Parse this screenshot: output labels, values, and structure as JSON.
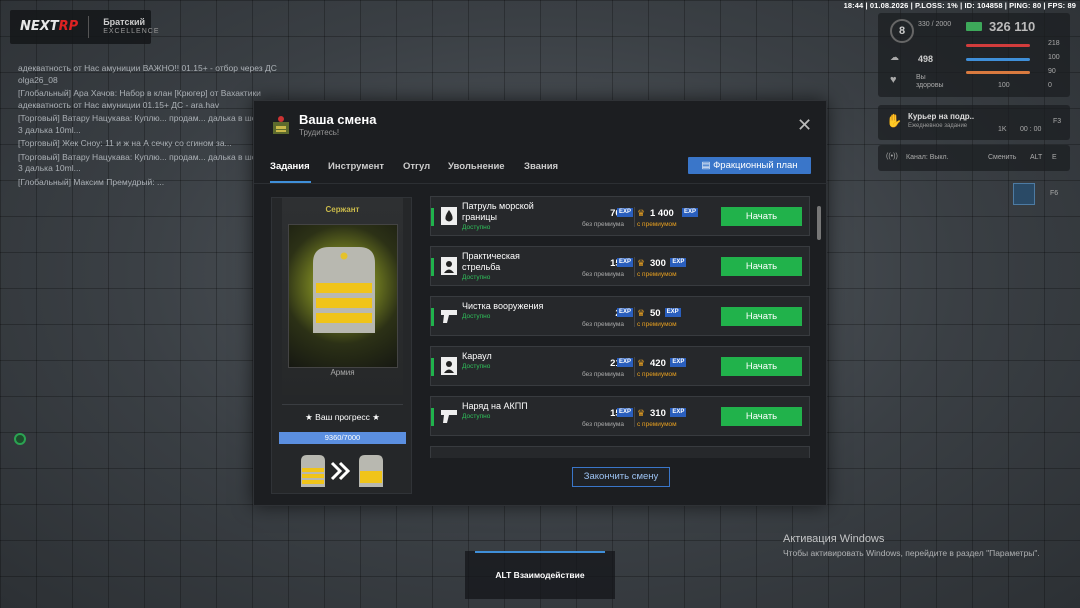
{
  "top_stats": "18:44 | 01.08.2026 | P.LOSS: 1% | ID: 104858 | PING: 80 | FPS: 89",
  "logo": {
    "brand_a": "NEXT",
    "brand_b": "RP",
    "server": "Братский",
    "server_sub": "EXCELLENCE"
  },
  "chat": [
    "адекватность от Нас амуниции ВАЖНО!! 01.15+ - отбор через ДС olga26_08",
    "[Глобальный] Ара Хачов: Набор в клан [Крюгер] от Вахактики адекватность от Нас амуниции 01.15+ ДС - ara.hav",
    "[Торговый] Ватару Нацукава: Куплю... продам... далька в шопе спас 3 далька 10ml...",
    "[Торговый] Жек Сноу: 11 и ж на А сечку со сгином за...",
    "[Торговый] Ватару Нацукава: Куплю... продам... далька в шопе спас 3 далька 10ml...",
    "[Глобальный] Максим Премудрый: ..."
  ],
  "hud": {
    "level": "8",
    "exp_small": "330 / 2000",
    "money": "326 110",
    "value_498": "498",
    "side_note": "Вы здоровы",
    "stat_218": "218",
    "stat_100": "100",
    "stat_90": "90",
    "stat_0": "0",
    "stat_100b": "100",
    "courier_title": "Курьер на подр..",
    "courier_sub": "Ежедневное задание",
    "courier_1k": "1K",
    "courier_time": "00 : 00",
    "courier_key": "F3",
    "channel": "Канал: Выкл.",
    "switch": "Сменить",
    "key_alt": "ALT",
    "key_e": "E",
    "key_f6": "F6"
  },
  "modal": {
    "title": "Ваша смена",
    "subtitle": "Трудитесь!",
    "close": "✕",
    "tabs": [
      "Задания",
      "Инструмент",
      "Отгул",
      "Увольнение",
      "Звания"
    ],
    "plan_button": "Фракционный план",
    "rank": "Сержант",
    "faction": "Армия",
    "progress_label": "★ Ваш прогресс ★",
    "progress_text": "9360/7000",
    "progress_fraction": 1.0,
    "finish_button": "Закончить смену",
    "exp_tag": "EXP",
    "no_premium": "без премиума",
    "with_premium": "с премиумом",
    "crown": "♛",
    "tasks": [
      {
        "name": "Патруль морской границы",
        "status": "Доступно",
        "base": "700",
        "premium": "1 400",
        "button": "Начать",
        "icon": "water-drop-icon"
      },
      {
        "name": "Практическая стрельба",
        "status": "Доступно",
        "base": "150",
        "premium": "300",
        "button": "Начать",
        "icon": "target-icon"
      },
      {
        "name": "Чистка вооружения",
        "status": "Доступно",
        "base": "25",
        "premium": "50",
        "button": "Начать",
        "icon": "gun-icon"
      },
      {
        "name": "Караул",
        "status": "Доступно",
        "base": "210",
        "premium": "420",
        "button": "Начать",
        "icon": "target-icon"
      },
      {
        "name": "Наряд на АКПП",
        "status": "Доступно",
        "base": "155",
        "premium": "310",
        "button": "Начать",
        "icon": "gun-icon"
      }
    ]
  },
  "bottom": {
    "interact": "ALT Взаимодействие",
    "win_title": "Активация Windows",
    "win_sub": "Чтобы активировать Windows, перейдите в раздел \"Параметры\"."
  }
}
